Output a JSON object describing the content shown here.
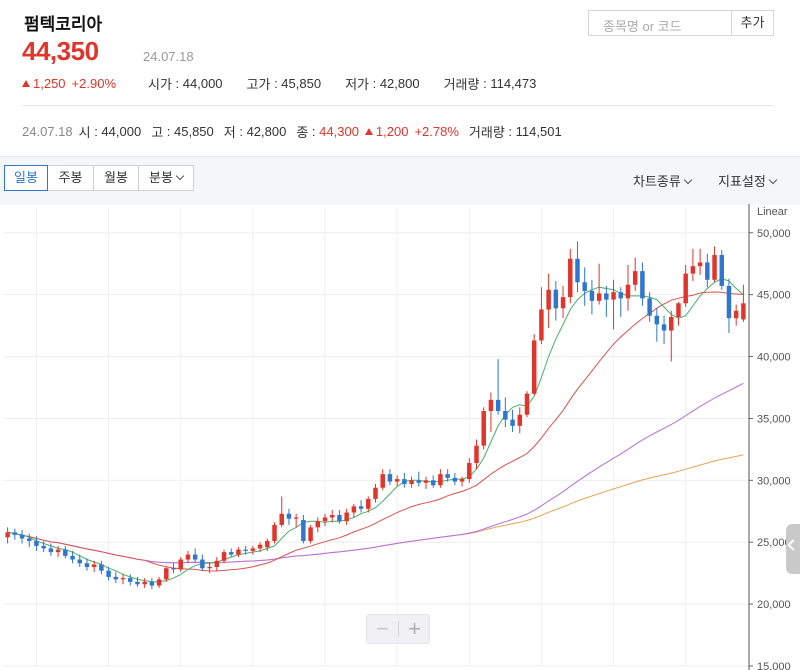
{
  "stock": {
    "name": "펌텍코리아",
    "price": "44,350",
    "date": "24.07.18",
    "change": "1,250",
    "change_pct": "+2.90%",
    "open_label": "시가",
    "open": "44,000",
    "high_label": "고가",
    "high": "45,850",
    "low_label": "저가",
    "low": "42,800",
    "volume_label": "거래량",
    "volume": "114,473"
  },
  "search": {
    "placeholder": "종목명 or 코드",
    "add_label": "추가"
  },
  "summary": {
    "date": "24.07.18",
    "open_label": "시",
    "open": "44,000",
    "high_label": "고",
    "high": "45,850",
    "low_label": "저",
    "low": "42,800",
    "close_label": "종",
    "close": "44,300",
    "change": "1,200",
    "change_pct": "+2.78%",
    "volume_label": "거래량",
    "volume": "114,501"
  },
  "tabs": {
    "daily": "일봉",
    "weekly": "주봉",
    "monthly": "월봉",
    "minute": "분봉",
    "chart_type": "차트종류",
    "indicator": "지표설정"
  },
  "colors": {
    "up": "#e1352b",
    "down": "#2e76d0",
    "ma5": "#4caf6a",
    "ma20": "#d9534f",
    "ma60": "#b76fe0",
    "ma120": "#e8a454"
  },
  "chart_data": {
    "type": "candlestick",
    "scale_label": "Linear",
    "y_scale": "linear",
    "ylim": [
      15000,
      52000
    ],
    "yticks": [
      15000,
      20000,
      25000,
      30000,
      35000,
      40000,
      45000,
      50000
    ],
    "ytick_labels": [
      "15,000",
      "20,000",
      "25,000",
      "30,000",
      "35,000",
      "40,000",
      "45,000",
      "50,000"
    ],
    "grid": true,
    "candles": [
      [
        25400,
        26200,
        24900,
        25800
      ],
      [
        25800,
        26100,
        25200,
        25600
      ],
      [
        25600,
        26000,
        24900,
        25300
      ],
      [
        25300,
        25700,
        24600,
        25100
      ],
      [
        25100,
        25500,
        24300,
        24700
      ],
      [
        24700,
        25100,
        24200,
        24500
      ],
      [
        24500,
        24900,
        23900,
        24200
      ],
      [
        24200,
        24700,
        23800,
        24400
      ],
      [
        24400,
        24700,
        23700,
        23900
      ],
      [
        23900,
        24300,
        23300,
        23600
      ],
      [
        23600,
        24000,
        23000,
        23300
      ],
      [
        23300,
        23700,
        22700,
        23000
      ],
      [
        23000,
        23500,
        22600,
        23200
      ],
      [
        23200,
        23500,
        22400,
        22700
      ],
      [
        22700,
        23000,
        21900,
        22200
      ],
      [
        22200,
        22600,
        21700,
        22000
      ],
      [
        22000,
        22400,
        21600,
        22100
      ],
      [
        22100,
        22400,
        21500,
        21800
      ],
      [
        21800,
        22200,
        21400,
        21600
      ],
      [
        21600,
        22100,
        21300,
        21800
      ],
      [
        21800,
        22100,
        21200,
        21500
      ],
      [
        21500,
        22200,
        21300,
        22000
      ],
      [
        22000,
        23000,
        21800,
        22900
      ],
      [
        22900,
        23300,
        22500,
        22800
      ],
      [
        22800,
        23800,
        22600,
        23600
      ],
      [
        23600,
        24300,
        23300,
        24000
      ],
      [
        24000,
        24500,
        23400,
        23600
      ],
      [
        23600,
        24000,
        22700,
        22900
      ],
      [
        22900,
        23400,
        22500,
        23000
      ],
      [
        23000,
        23800,
        22700,
        23500
      ],
      [
        23500,
        24400,
        23300,
        24200
      ],
      [
        24200,
        24500,
        23800,
        24000
      ],
      [
        24000,
        24600,
        23800,
        24400
      ],
      [
        24400,
        24700,
        24000,
        24300
      ],
      [
        24300,
        24700,
        24000,
        24500
      ],
      [
        24500,
        25000,
        24200,
        24800
      ],
      [
        24600,
        25300,
        24300,
        25100
      ],
      [
        25100,
        26600,
        24900,
        26400
      ],
      [
        26400,
        28700,
        26200,
        27300
      ],
      [
        27300,
        27700,
        26400,
        26900
      ],
      [
        26900,
        27300,
        26200,
        27000
      ],
      [
        26800,
        27200,
        24900,
        25100
      ],
      [
        25100,
        26400,
        24900,
        26200
      ],
      [
        26200,
        27000,
        25800,
        26700
      ],
      [
        26700,
        27300,
        26300,
        27000
      ],
      [
        27000,
        27600,
        26600,
        27200
      ],
      [
        27200,
        27600,
        26500,
        26700
      ],
      [
        26700,
        27700,
        26400,
        27400
      ],
      [
        27400,
        28100,
        27000,
        27900
      ],
      [
        27900,
        28400,
        27400,
        27700
      ],
      [
        27700,
        28700,
        27400,
        28500
      ],
      [
        28500,
        29700,
        28200,
        29400
      ],
      [
        29400,
        30900,
        29200,
        30500
      ],
      [
        30500,
        30900,
        29600,
        29900
      ],
      [
        29900,
        30400,
        29500,
        30100
      ],
      [
        30100,
        30600,
        29400,
        29700
      ],
      [
        29700,
        30300,
        29400,
        30000
      ],
      [
        30000,
        30700,
        29500,
        29800
      ],
      [
        29800,
        30300,
        29300,
        30000
      ],
      [
        30000,
        30400,
        29400,
        29600
      ],
      [
        29600,
        30900,
        29400,
        30500
      ],
      [
        30500,
        30900,
        29900,
        30200
      ],
      [
        30200,
        30600,
        29600,
        29900
      ],
      [
        29900,
        30300,
        29500,
        30100
      ],
      [
        30100,
        31800,
        29800,
        31400
      ],
      [
        31400,
        33300,
        30900,
        32800
      ],
      [
        32800,
        35900,
        32500,
        35600
      ],
      [
        35600,
        37100,
        33900,
        36500
      ],
      [
        36500,
        39800,
        35300,
        35600
      ],
      [
        35600,
        36700,
        34300,
        34900
      ],
      [
        34900,
        35700,
        33900,
        34400
      ],
      [
        34400,
        35900,
        33800,
        35300
      ],
      [
        35300,
        37200,
        35100,
        37000
      ],
      [
        37000,
        41800,
        36900,
        41300
      ],
      [
        41300,
        45600,
        41000,
        43800
      ],
      [
        43800,
        46700,
        42300,
        45400
      ],
      [
        45400,
        46100,
        42900,
        43900
      ],
      [
        43900,
        45700,
        43100,
        44800
      ],
      [
        44800,
        48700,
        44300,
        47900
      ],
      [
        47900,
        49300,
        45200,
        46000
      ],
      [
        46000,
        47200,
        44100,
        45300
      ],
      [
        45300,
        46200,
        43400,
        44500
      ],
      [
        44500,
        47500,
        44200,
        45100
      ],
      [
        45100,
        45700,
        43200,
        44600
      ],
      [
        44600,
        46200,
        42200,
        45200
      ],
      [
        45200,
        45600,
        43200,
        44700
      ],
      [
        44700,
        47400,
        43700,
        45800
      ],
      [
        45800,
        48000,
        45300,
        46900
      ],
      [
        46900,
        47600,
        44100,
        44700
      ],
      [
        44700,
        45200,
        42800,
        43300
      ],
      [
        43300,
        43900,
        41200,
        42600
      ],
      [
        42600,
        43300,
        41000,
        42100
      ],
      [
        42100,
        43700,
        39600,
        43200
      ],
      [
        43200,
        44400,
        42500,
        44300
      ],
      [
        44300,
        47400,
        44000,
        46700
      ],
      [
        46700,
        48700,
        46100,
        47300
      ],
      [
        47300,
        48700,
        46600,
        47600
      ],
      [
        47600,
        48300,
        45600,
        46200
      ],
      [
        46200,
        48900,
        46000,
        48200
      ],
      [
        48200,
        48600,
        45400,
        45700
      ],
      [
        45700,
        46300,
        41900,
        43100
      ],
      [
        43100,
        44200,
        42500,
        43700
      ],
      [
        43000,
        45800,
        42800,
        44300
      ]
    ],
    "ma5": [
      25800,
      25700,
      25600,
      25400,
      25100,
      24900,
      24700,
      24500,
      24400,
      24200,
      23900,
      23600,
      23400,
      23200,
      22900,
      22700,
      22400,
      22200,
      22000,
      21900,
      21800,
      21800,
      21900,
      22100,
      22400,
      22800,
      23100,
      23300,
      23300,
      23400,
      23600,
      23800,
      24000,
      24100,
      24200,
      24300,
      24500,
      24700,
      25300,
      25900,
      26200,
      26600,
      26700,
      26700,
      26600,
      26700,
      26700,
      26800,
      27000,
      27300,
      27500,
      27800,
      28300,
      28900,
      29500,
      29900,
      30000,
      30000,
      29900,
      29900,
      29900,
      30000,
      30100,
      30100,
      30300,
      30900,
      31800,
      33100,
      34400,
      35300,
      35900,
      36100,
      36000,
      36800,
      38300,
      40000,
      41400,
      42600,
      43800,
      44600,
      45100,
      45400,
      45600,
      45500,
      45400,
      45100,
      44900,
      44900,
      44900,
      44800,
      44600,
      44000,
      43400,
      43100,
      43300,
      44100,
      44900,
      45500,
      46000,
      46300,
      46100,
      45500,
      45000
    ]
  }
}
